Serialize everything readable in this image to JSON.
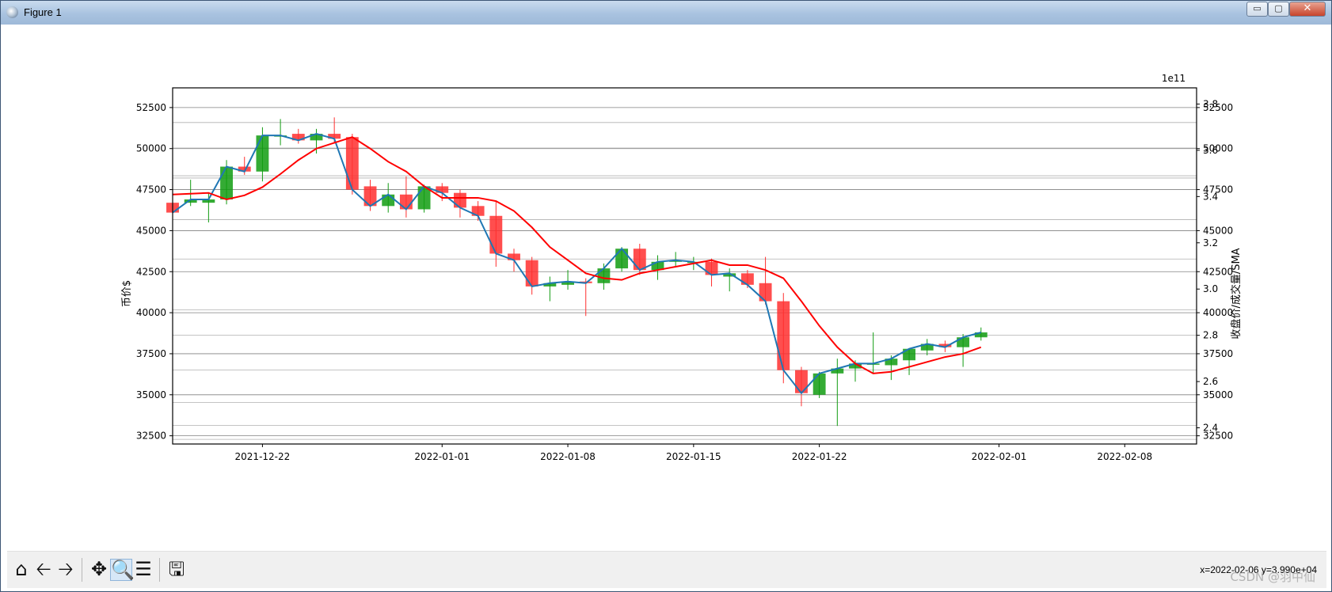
{
  "window": {
    "title": "Figure 1",
    "min_symbol": "▭",
    "max_symbol": "▢",
    "close_symbol": "✕"
  },
  "toolbar": {
    "buttons": [
      {
        "name": "home-icon",
        "glyph": "⌂"
      },
      {
        "name": "back-icon",
        "glyph": "🡠"
      },
      {
        "name": "forward-icon",
        "glyph": "🡢"
      },
      {
        "name": "pan-icon",
        "glyph": "✥"
      },
      {
        "name": "zoom-icon",
        "glyph": "🔍"
      },
      {
        "name": "configure-subplots-icon",
        "glyph": "☰"
      },
      {
        "name": "save-icon",
        "glyph": "🖫"
      }
    ],
    "active": "zoom-icon",
    "coord_readout": "x=2022-02-06 y=3.990e+04"
  },
  "watermark": "CSDN @羽中仙",
  "colors": {
    "up": "#ff2f2f",
    "down": "#119c11",
    "close_line": "#1f77b4",
    "sma_line": "#ff0000",
    "grid": "#808080"
  },
  "chart_data": {
    "type": "candlestick",
    "ylabel": "币价$",
    "y2label": "收盘价/成交量/SMA",
    "y2_offset_text": "1e11",
    "ylim": [
      32000,
      53700
    ],
    "y2lim": [
      2.33,
      3.87
    ],
    "yticks": [
      32500,
      35000,
      37500,
      40000,
      42500,
      45000,
      47500,
      50000,
      52500
    ],
    "y2ticks": [
      2.4,
      2.6,
      2.8,
      3.0,
      3.2,
      3.4,
      3.6,
      3.8
    ],
    "xlim": [
      "2021-12-17",
      "2022-02-12"
    ],
    "xticks": [
      "2021-12-22",
      "2022-01-01",
      "2022-01-08",
      "2022-01-15",
      "2022-01-22",
      "2022-02-01",
      "2022-02-08"
    ],
    "grid": "horizontal",
    "candles": [
      {
        "date": "2021-12-17",
        "open": 46700,
        "high": 47000,
        "low": 45500,
        "close": 46100
      },
      {
        "date": "2021-12-18",
        "open": 46700,
        "high": 48100,
        "low": 46500,
        "close": 46900
      },
      {
        "date": "2021-12-19",
        "open": 46700,
        "high": 47300,
        "low": 45500,
        "close": 46900
      },
      {
        "date": "2021-12-20",
        "open": 46900,
        "high": 49300,
        "low": 46600,
        "close": 48900
      },
      {
        "date": "2021-12-21",
        "open": 48900,
        "high": 49500,
        "low": 48400,
        "close": 48600
      },
      {
        "date": "2021-12-22",
        "open": 48600,
        "high": 51300,
        "low": 48000,
        "close": 50800
      },
      {
        "date": "2021-12-23",
        "open": 50800,
        "high": 51800,
        "low": 50200,
        "close": 50800
      },
      {
        "date": "2021-12-24",
        "open": 50900,
        "high": 51200,
        "low": 50300,
        "close": 50500
      },
      {
        "date": "2021-12-25",
        "open": 50500,
        "high": 51200,
        "low": 49700,
        "close": 50900
      },
      {
        "date": "2021-12-26",
        "open": 50900,
        "high": 51900,
        "low": 50300,
        "close": 50600
      },
      {
        "date": "2021-12-27",
        "open": 50700,
        "high": 50900,
        "low": 47200,
        "close": 47500
      },
      {
        "date": "2021-12-28",
        "open": 47700,
        "high": 48100,
        "low": 46200,
        "close": 46500
      },
      {
        "date": "2021-12-29",
        "open": 46500,
        "high": 47900,
        "low": 46100,
        "close": 47200
      },
      {
        "date": "2021-12-30",
        "open": 47200,
        "high": 48300,
        "low": 45800,
        "close": 46300
      },
      {
        "date": "2021-12-31",
        "open": 46300,
        "high": 47800,
        "low": 46100,
        "close": 47700
      },
      {
        "date": "2022-01-01",
        "open": 47700,
        "high": 47900,
        "low": 46800,
        "close": 47300
      },
      {
        "date": "2022-01-02",
        "open": 47300,
        "high": 47500,
        "low": 45800,
        "close": 46400
      },
      {
        "date": "2022-01-03",
        "open": 46500,
        "high": 46800,
        "low": 45600,
        "close": 45900
      },
      {
        "date": "2022-01-04",
        "open": 45900,
        "high": 46800,
        "low": 42800,
        "close": 43600
      },
      {
        "date": "2022-01-05",
        "open": 43600,
        "high": 43900,
        "low": 42500,
        "close": 43200
      },
      {
        "date": "2022-01-06",
        "open": 43200,
        "high": 43400,
        "low": 41100,
        "close": 41600
      },
      {
        "date": "2022-01-07",
        "open": 41600,
        "high": 42200,
        "low": 40700,
        "close": 41800
      },
      {
        "date": "2022-01-08",
        "open": 41700,
        "high": 42600,
        "low": 41400,
        "close": 41900
      },
      {
        "date": "2022-01-09",
        "open": 41900,
        "high": 42100,
        "low": 39800,
        "close": 41800
      },
      {
        "date": "2022-01-10",
        "open": 41800,
        "high": 43000,
        "low": 41400,
        "close": 42700
      },
      {
        "date": "2022-01-11",
        "open": 42700,
        "high": 44000,
        "low": 42500,
        "close": 43900
      },
      {
        "date": "2022-01-12",
        "open": 43900,
        "high": 44200,
        "low": 42300,
        "close": 42600
      },
      {
        "date": "2022-01-13",
        "open": 42600,
        "high": 43500,
        "low": 42000,
        "close": 43100
      },
      {
        "date": "2022-01-14",
        "open": 43100,
        "high": 43700,
        "low": 42800,
        "close": 43200
      },
      {
        "date": "2022-01-15",
        "open": 43100,
        "high": 43400,
        "low": 42600,
        "close": 43100
      },
      {
        "date": "2022-01-16",
        "open": 43100,
        "high": 43300,
        "low": 41600,
        "close": 42300
      },
      {
        "date": "2022-01-17",
        "open": 42200,
        "high": 42700,
        "low": 41300,
        "close": 42400
      },
      {
        "date": "2022-01-18",
        "open": 42400,
        "high": 42600,
        "low": 41500,
        "close": 41700
      },
      {
        "date": "2022-01-19",
        "open": 41800,
        "high": 43400,
        "low": 40500,
        "close": 40700
      },
      {
        "date": "2022-01-20",
        "open": 40700,
        "high": 41200,
        "low": 35700,
        "close": 36500
      },
      {
        "date": "2022-01-21",
        "open": 36500,
        "high": 36700,
        "low": 34300,
        "close": 35100
      },
      {
        "date": "2022-01-22",
        "open": 35000,
        "high": 36400,
        "low": 34800,
        "close": 36300
      },
      {
        "date": "2022-01-23",
        "open": 36300,
        "high": 37200,
        "low": 33100,
        "close": 36600
      },
      {
        "date": "2022-01-24",
        "open": 36600,
        "high": 37100,
        "low": 35800,
        "close": 36900
      },
      {
        "date": "2022-01-25",
        "open": 36900,
        "high": 38800,
        "low": 36300,
        "close": 36900
      },
      {
        "date": "2022-01-26",
        "open": 36800,
        "high": 37400,
        "low": 35900,
        "close": 37200
      },
      {
        "date": "2022-01-27",
        "open": 37100,
        "high": 37800,
        "low": 36200,
        "close": 37800
      },
      {
        "date": "2022-01-28",
        "open": 37700,
        "high": 38400,
        "low": 37400,
        "close": 38100
      },
      {
        "date": "2022-01-29",
        "open": 38100,
        "high": 38300,
        "low": 37600,
        "close": 37900
      },
      {
        "date": "2022-01-30",
        "open": 37900,
        "high": 38700,
        "low": 36700,
        "close": 38500
      },
      {
        "date": "2022-01-31",
        "open": 38500,
        "high": 39100,
        "low": 38300,
        "close": 38800
      }
    ],
    "sma": [
      47200,
      47250,
      47300,
      46900,
      47150,
      47650,
      48450,
      49300,
      50000,
      50350,
      50700,
      50000,
      49200,
      48600,
      47700,
      47000,
      47000,
      47000,
      46800,
      46200,
      45200,
      44000,
      43200,
      42400,
      42100,
      42000,
      42400,
      42600,
      42800,
      43000,
      43200,
      42900,
      42900,
      42600,
      42100,
      40700,
      39200,
      37900,
      36900,
      36300,
      36400,
      36700,
      37000,
      37300,
      37500,
      37900
    ],
    "volume_gridlines": [
      2.35,
      2.41,
      2.51,
      2.65,
      2.8,
      2.91,
      3.13,
      3.3,
      3.48,
      3.49,
      3.61,
      3.72
    ]
  }
}
